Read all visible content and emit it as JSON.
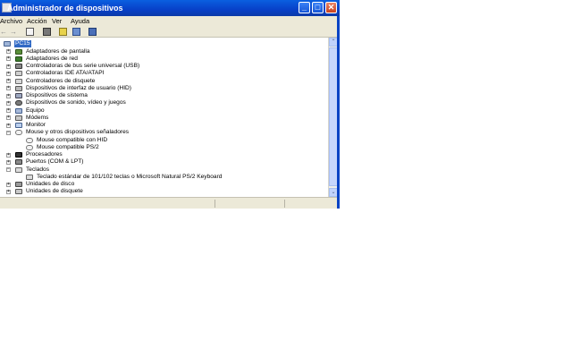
{
  "window": {
    "title": "Administrador de dispositivos",
    "title_icon": "device-manager-icon",
    "controls": [
      "minimize-icon",
      "maximize-icon",
      "close-icon"
    ],
    "title_color": "#0a5fe0"
  },
  "menu": [
    "Archivo",
    "Acción",
    "Ver",
    "Ayuda"
  ],
  "toolbar": [
    "back-arrow-icon",
    "forward-arrow-icon",
    "properties-icon",
    "print-icon",
    "help-icon",
    "view-icon",
    "scan-hardware-icon"
  ],
  "tree": {
    "root": "PC15",
    "items": [
      {
        "label": "Adaptadores de pantalla",
        "expander": "+",
        "icon": "display-adapter-icon"
      },
      {
        "label": "Adaptadores de red",
        "expander": "+",
        "icon": "network-adapter-icon"
      },
      {
        "label": "Controladoras de bus serie universal (USB)",
        "expander": "+",
        "icon": "usb-icon"
      },
      {
        "label": "Controladoras IDE ATA/ATAPI",
        "expander": "+",
        "icon": "ide-icon"
      },
      {
        "label": "Controladores de disquete",
        "expander": "+",
        "icon": "floppy-controller-icon"
      },
      {
        "label": "Dispositivos de interfaz de usuario (HID)",
        "expander": "+",
        "icon": "hid-icon"
      },
      {
        "label": "Dispositivos de sistema",
        "expander": "+",
        "icon": "system-device-icon"
      },
      {
        "label": "Dispositivos de sonido, vídeo y juegos",
        "expander": "+",
        "icon": "sound-icon"
      },
      {
        "label": "Equipo",
        "expander": "+",
        "icon": "computer-icon"
      },
      {
        "label": "Módems",
        "expander": "+",
        "icon": "modem-icon"
      },
      {
        "label": "Monitor",
        "expander": "+",
        "icon": "monitor-icon"
      },
      {
        "label": "Mouse y otros dispositivos señaladores",
        "expander": "−",
        "icon": "mouse-icon"
      },
      {
        "label": "Mouse compatible con HID",
        "child": true,
        "icon": "mouse-icon"
      },
      {
        "label": "Mouse compatible PS/2",
        "child": true,
        "icon": "mouse-icon"
      },
      {
        "label": "Procesadores",
        "expander": "+",
        "icon": "processor-icon"
      },
      {
        "label": "Puertos (COM & LPT)",
        "expander": "+",
        "icon": "port-icon"
      },
      {
        "label": "Teclados",
        "expander": "−",
        "icon": "keyboard-icon"
      },
      {
        "label": "Teclado estándar de 101/102 teclas o Microsoft Natural PS/2 Keyboard",
        "child": true,
        "icon": "keyboard-icon"
      },
      {
        "label": "Unidades de disco",
        "expander": "+",
        "icon": "disk-drive-icon"
      },
      {
        "label": "Unidades de disquete",
        "expander": "+",
        "icon": "floppy-drive-icon"
      }
    ]
  },
  "colors": {
    "selection": "#316ac5",
    "titlebar": "#0a5fe0",
    "window_bg": "#ece9d8"
  }
}
